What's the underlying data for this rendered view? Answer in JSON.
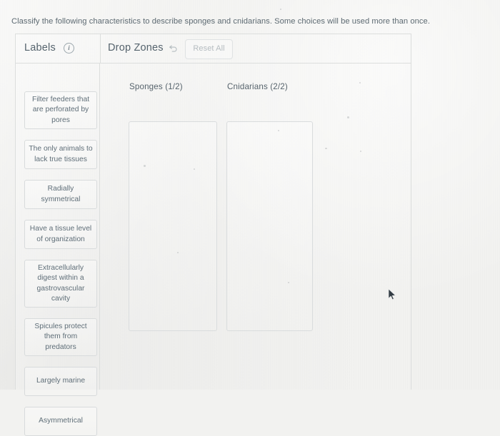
{
  "question": {
    "text": "Classify the following characteristics to describe sponges and cnidarians. Some choices will be used more than once."
  },
  "panel": {
    "labels_header": {
      "title": "Labels",
      "info_icon": "info-circle-icon",
      "info_glyph": "i"
    },
    "dropzones_header": {
      "title": "Drop Zones",
      "undo_icon": "undo-arrow-icon",
      "reset_label": "Reset All"
    },
    "labels": [
      {
        "text": "Filter feeders that are perforated by pores"
      },
      {
        "text": "The only animals to lack true tissues"
      },
      {
        "text": "Radially symmetrical"
      },
      {
        "text": "Have a tissue level of organization"
      },
      {
        "text": "Extracellularly digest within a gastrovascular cavity"
      },
      {
        "text": "Spicules protect them from predators"
      },
      {
        "text": "Largely marine"
      },
      {
        "text": "Asymmetrical"
      }
    ],
    "drop_zones": [
      {
        "title": "Sponges (1/2)",
        "items": []
      },
      {
        "title": "Cnidarians (2/2)",
        "items": []
      }
    ]
  },
  "cursor": {
    "icon": "mouse-pointer-icon"
  },
  "colors": {
    "background": "#f1f1ef",
    "panel_border": "#dcdedd",
    "heading_text": "#55636d",
    "body_text": "#5d6a72",
    "chip_border": "#d8dbdc",
    "muted_text": "#b5bcc0"
  }
}
